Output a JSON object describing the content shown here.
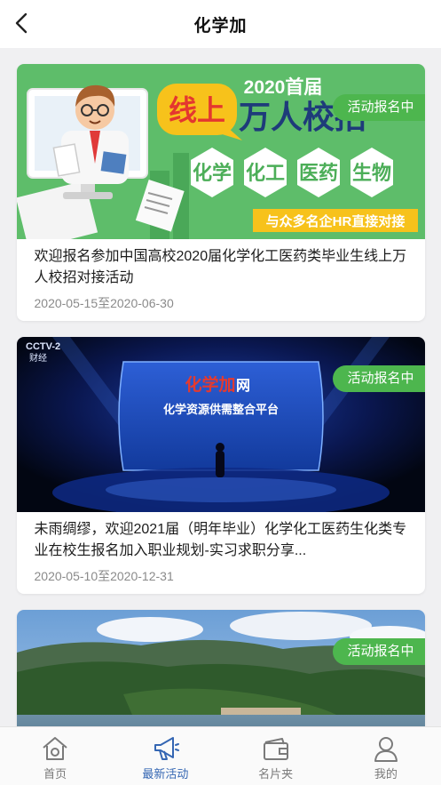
{
  "header": {
    "title": "化学加"
  },
  "colors": {
    "accent_green": "#4db64e",
    "active_tab": "#3466b3",
    "inactive_tab": "#7a7a7a"
  },
  "cards": [
    {
      "badge": "活动报名中",
      "title": "欢迎报名参加中国高校2020届化学化工医药类毕业生线上万人校招对接活动",
      "date": "2020-05-15至2020-06-30",
      "banner": {
        "line1": "线上",
        "line2": "2020首届",
        "line3": "万人校招",
        "tags": [
          "化学",
          "化工",
          "医药",
          "生物"
        ],
        "footer": "与众多名企HR直接对接"
      }
    },
    {
      "badge": "活动报名中",
      "title": "未雨绸缪，欢迎2021届（明年毕业）化学化工医药生化类专业在校生报名加入职业规划-实习求职分享...",
      "date": "2020-05-10至2020-12-31",
      "banner": {
        "brand": "化学加",
        "brand_suffix": "网",
        "slogan": "化学资源供需整合平台",
        "channel": "CCTV-2",
        "channel_sub": "财经"
      }
    },
    {
      "badge": "活动报名中"
    }
  ],
  "tabbar": [
    {
      "label": "首页",
      "icon": "home-icon",
      "active": false
    },
    {
      "label": "最新活动",
      "icon": "megaphone-icon",
      "active": true
    },
    {
      "label": "名片夹",
      "icon": "card-holder-icon",
      "active": false
    },
    {
      "label": "我的",
      "icon": "user-icon",
      "active": false
    }
  ]
}
